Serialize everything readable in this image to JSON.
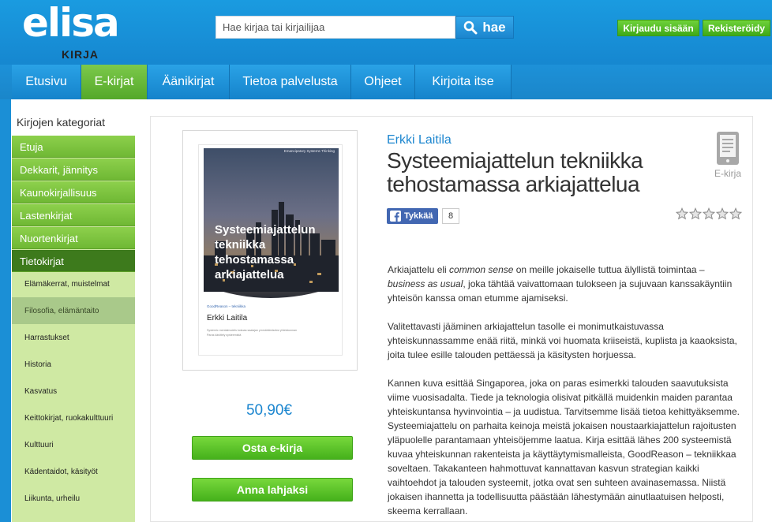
{
  "header": {
    "logo_word": "elisa",
    "logo_sub": "KIRJA",
    "search_placeholder": "Hae kirjaa tai kirjailijaa",
    "search_button": "hae",
    "login_button": "Kirjaudu sisään",
    "register_button": "Rekisteröidy"
  },
  "nav": {
    "items": [
      "Etusivu",
      "E-kirjat",
      "Äänikirjat",
      "Tietoa palvelusta",
      "Ohjeet",
      "Kirjoita itse"
    ],
    "active": "E-kirjat"
  },
  "sidebar": {
    "title": "Kirjojen kategoriat",
    "categories": [
      "Etuja",
      "Dekkarit, jännitys",
      "Kaunokirjallisuus",
      "Lastenkirjat",
      "Nuortenkirjat",
      "Tietokirjat"
    ],
    "subcategories": [
      "Elämäkerrat, muistelmat",
      "Filosofia, elämäntaito",
      "Harrastukset",
      "Historia",
      "Kasvatus",
      "Keittokirjat, ruokakulttuuri",
      "Kulttuuri",
      "Kädentaidot, käsityöt",
      "Liikunta, urheilu"
    ]
  },
  "book": {
    "author": "Erkki Laitila",
    "title": "Systeemiajattelun tekniikka tehostamassa arkiajattelua",
    "format_label": "E-kirja",
    "price": "50,90€",
    "buy_button": "Osta e-kirja",
    "gift_button": "Anna lahjaksi",
    "like_label": "Tykkää",
    "like_count": "8",
    "rating": 0,
    "cover": {
      "series": "Emancipatory Systems Thinking",
      "title_lines": [
        "Systeemiajattelun",
        "tekniikka",
        "tehostamassa",
        "arkiajattelua"
      ],
      "tagline": "GoodReason – tekniikka",
      "author": "Erkki Laitila",
      "blurb_lines": [
        "Systemic mentalmodels kokoaa saaiajan ymmärtämiseksi yhteiskunnan",
        "Paras käsittely systeemistä"
      ]
    },
    "description": {
      "p1_a": "Arkiajattelu eli ",
      "p1_em1": "common sense",
      "p1_b": " on meille jokaiselle tuttua älyllistä toimintaa – ",
      "p1_em2": "business as usual",
      "p1_c": ", joka tähtää vaivattomaan tulokseen ja sujuvaan kanssakäyntiin yhteisön kanssa oman etumme ajamiseksi.",
      "p2": "Valitettavasti jääminen arkiajattelun tasolle ei monimutkaistuvassa yhteiskunnassamme enää riitä, minkä voi huomata kriiseistä, kuplista ja kaaoksista, joita tulee esille talouden pettäessä ja käsitysten horjuessa.",
      "p3": "Kannen kuva esittää Singaporea, joka on paras esimerkki talouden saavutuksista viime vuosisadalta. Tiede ja teknologia olisivat pitkällä muidenkin maiden parantaa yhteiskuntansa hyvinvointia – ja uudistua. Tarvitsemme lisää tietoa kehittyäksemme. Systeemiajattelu on parhaita keinoja meistä jokaisen noustaarkiajattelun rajoitusten yläpuolelle parantamaan yhteisöjemme laatua. Kirja esittää lähes 200 systeemistä kuvaa yhteiskunnan rakenteista ja käyttäytymismalleista, GoodReason – tekniikkaa soveltaen. Takakanteen hahmottuvat kannattavan kasvun strategian kaikki vaihtoehdot ja talouden systeemit, jotka ovat sen suhteen avainasemassa. Niistä jokaisen ihannetta ja todellisuutta päästään lähestymään ainutlaatuisen helposti, skeema kerrallaan."
    }
  },
  "colors": {
    "brand_blue": "#1a8fd6",
    "green": "#56b523",
    "link_blue": "#1c86cf"
  }
}
